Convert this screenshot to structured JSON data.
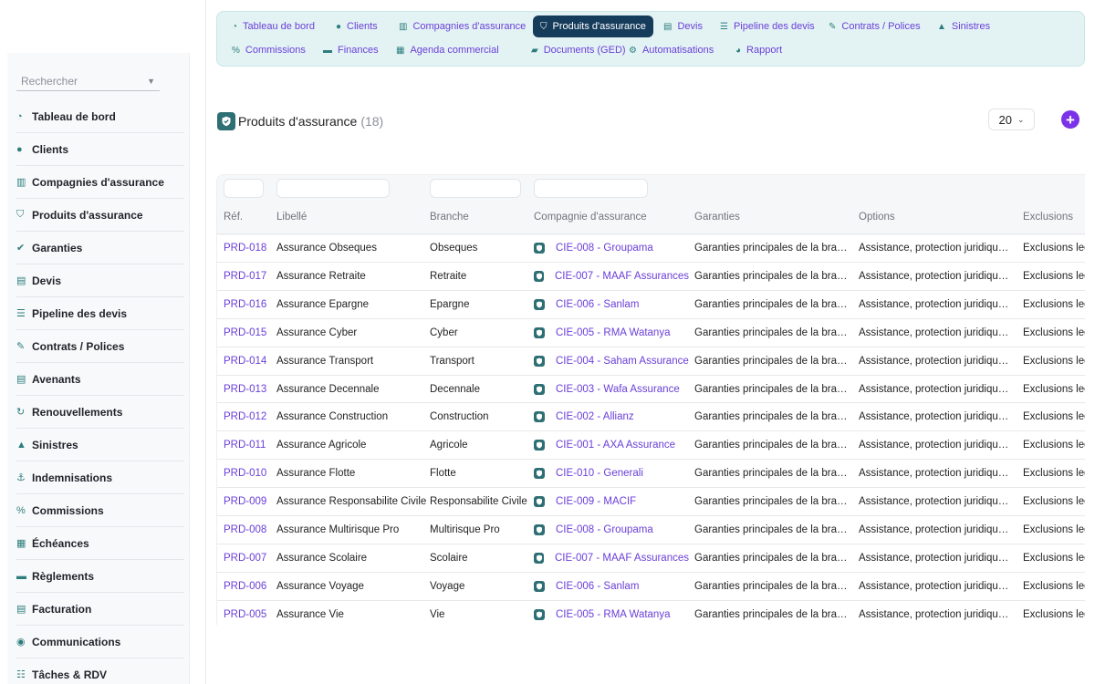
{
  "search": {
    "placeholder": "Rechercher"
  },
  "sidebar": {
    "items": [
      {
        "label": "Tableau de bord",
        "icon": "dashboard-icon",
        "glyph": "◔"
      },
      {
        "label": "Clients",
        "icon": "user-icon",
        "glyph": "●"
      },
      {
        "label": "Compagnies d'assurance",
        "icon": "bank-icon",
        "glyph": "▥"
      },
      {
        "label": "Produits d'assurance",
        "icon": "shield-icon",
        "glyph": "⛉"
      },
      {
        "label": "Garanties",
        "icon": "check-badge-icon",
        "glyph": "✔"
      },
      {
        "label": "Devis",
        "icon": "document-icon",
        "glyph": "▤"
      },
      {
        "label": "Pipeline des devis",
        "icon": "list-icon",
        "glyph": "☰"
      },
      {
        "label": "Contrats / Polices",
        "icon": "contract-icon",
        "glyph": "✎"
      },
      {
        "label": "Avenants",
        "icon": "file-icon",
        "glyph": "▤"
      },
      {
        "label": "Renouvellements",
        "icon": "refresh-icon",
        "glyph": "↻"
      },
      {
        "label": "Sinistres",
        "icon": "warning-icon",
        "glyph": "▲"
      },
      {
        "label": "Indemnisations",
        "icon": "hand-coin-icon",
        "glyph": "⚓"
      },
      {
        "label": "Commissions",
        "icon": "percent-icon",
        "glyph": "%"
      },
      {
        "label": "Échéances",
        "icon": "calendar-icon",
        "glyph": "▦"
      },
      {
        "label": "Règlements",
        "icon": "money-icon",
        "glyph": "▬"
      },
      {
        "label": "Facturation",
        "icon": "invoice-icon",
        "glyph": "▤"
      },
      {
        "label": "Communications",
        "icon": "chat-icon",
        "glyph": "◉"
      },
      {
        "label": "Tâches & RDV",
        "icon": "tasks-icon",
        "glyph": "☷"
      }
    ]
  },
  "topnav": {
    "row1": [
      {
        "label": "Tableau de bord",
        "glyph": "◔"
      },
      {
        "label": "Clients",
        "glyph": "●"
      },
      {
        "label": "Compagnies d'assurance",
        "glyph": "▥"
      },
      {
        "label": "Produits d'assurance",
        "glyph": "⛉",
        "active": true
      },
      {
        "label": "Devis",
        "glyph": "▤"
      },
      {
        "label": "Pipeline des devis",
        "glyph": "☰"
      },
      {
        "label": "Contrats / Polices",
        "glyph": "✎"
      },
      {
        "label": "Sinistres",
        "glyph": "▲"
      }
    ],
    "row2": [
      {
        "label": "Commissions",
        "glyph": "%"
      },
      {
        "label": "Finances",
        "glyph": "▬"
      },
      {
        "label": "Agenda commercial",
        "glyph": "▦"
      },
      {
        "label": "Documents (GED)",
        "glyph": "▰"
      },
      {
        "label": "Automatisations",
        "glyph": "⚙"
      },
      {
        "label": "Rapport",
        "glyph": "◕"
      }
    ]
  },
  "page": {
    "title": "Produits d'assurance",
    "count": "(18)",
    "page_size": "20"
  },
  "table": {
    "columns": [
      "Réf.",
      "Libellé",
      "Branche",
      "Compagnie d'assurance",
      "Garanties",
      "Options",
      "Exclusions"
    ],
    "rows": [
      {
        "ref": "PRD-018",
        "libelle": "Assurance Obseques",
        "branche": "Obseques",
        "compagnie": "CIE-008 - Groupama",
        "garanties": "Garanties principales de la bran…",
        "options": "Assistance, protection juridique,…",
        "exclusions": "Exclusions leg"
      },
      {
        "ref": "PRD-017",
        "libelle": "Assurance Retraite",
        "branche": "Retraite",
        "compagnie": "CIE-007 - MAAF Assurances",
        "garanties": "Garanties principales de la bran…",
        "options": "Assistance, protection juridique,…",
        "exclusions": "Exclusions leg"
      },
      {
        "ref": "PRD-016",
        "libelle": "Assurance Epargne",
        "branche": "Epargne",
        "compagnie": "CIE-006 - Sanlam",
        "garanties": "Garanties principales de la bran…",
        "options": "Assistance, protection juridique,…",
        "exclusions": "Exclusions leg"
      },
      {
        "ref": "PRD-015",
        "libelle": "Assurance Cyber",
        "branche": "Cyber",
        "compagnie": "CIE-005 - RMA Watanya",
        "garanties": "Garanties principales de la bran…",
        "options": "Assistance, protection juridique,…",
        "exclusions": "Exclusions leg"
      },
      {
        "ref": "PRD-014",
        "libelle": "Assurance Transport",
        "branche": "Transport",
        "compagnie": "CIE-004 - Saham Assurance",
        "garanties": "Garanties principales de la bran…",
        "options": "Assistance, protection juridique,…",
        "exclusions": "Exclusions leg"
      },
      {
        "ref": "PRD-013",
        "libelle": "Assurance Decennale",
        "branche": "Decennale",
        "compagnie": "CIE-003 - Wafa Assurance",
        "garanties": "Garanties principales de la bran…",
        "options": "Assistance, protection juridique,…",
        "exclusions": "Exclusions leg"
      },
      {
        "ref": "PRD-012",
        "libelle": "Assurance Construction",
        "branche": "Construction",
        "compagnie": "CIE-002 - Allianz",
        "garanties": "Garanties principales de la bran…",
        "options": "Assistance, protection juridique,…",
        "exclusions": "Exclusions leg"
      },
      {
        "ref": "PRD-011",
        "libelle": "Assurance Agricole",
        "branche": "Agricole",
        "compagnie": "CIE-001 - AXA Assurance",
        "garanties": "Garanties principales de la bran…",
        "options": "Assistance, protection juridique,…",
        "exclusions": "Exclusions leg"
      },
      {
        "ref": "PRD-010",
        "libelle": "Assurance Flotte",
        "branche": "Flotte",
        "compagnie": "CIE-010 - Generali",
        "garanties": "Garanties principales de la bran…",
        "options": "Assistance, protection juridique,…",
        "exclusions": "Exclusions leg"
      },
      {
        "ref": "PRD-009",
        "libelle": "Assurance Responsabilite Civile",
        "branche": "Responsabilite Civile",
        "compagnie": "CIE-009 - MACIF",
        "garanties": "Garanties principales de la bran…",
        "options": "Assistance, protection juridique,…",
        "exclusions": "Exclusions leg"
      },
      {
        "ref": "PRD-008",
        "libelle": "Assurance Multirisque Pro",
        "branche": "Multirisque Pro",
        "compagnie": "CIE-008 - Groupama",
        "garanties": "Garanties principales de la bran…",
        "options": "Assistance, protection juridique,…",
        "exclusions": "Exclusions leg"
      },
      {
        "ref": "PRD-007",
        "libelle": "Assurance Scolaire",
        "branche": "Scolaire",
        "compagnie": "CIE-007 - MAAF Assurances",
        "garanties": "Garanties principales de la bran…",
        "options": "Assistance, protection juridique,…",
        "exclusions": "Exclusions leg"
      },
      {
        "ref": "PRD-006",
        "libelle": "Assurance Voyage",
        "branche": "Voyage",
        "compagnie": "CIE-006 - Sanlam",
        "garanties": "Garanties principales de la bran…",
        "options": "Assistance, protection juridique,…",
        "exclusions": "Exclusions leg"
      },
      {
        "ref": "PRD-005",
        "libelle": "Assurance Vie",
        "branche": "Vie",
        "compagnie": "CIE-005 - RMA Watanya",
        "garanties": "Garanties principales de la bran…",
        "options": "Assistance, protection juridique,…",
        "exclusions": "Exclusions leg"
      }
    ]
  },
  "colors": {
    "accent": "#6a3fd8",
    "active_tab": "#163c5c",
    "teal": "#2e6f74",
    "add_button": "#7a33e8"
  }
}
